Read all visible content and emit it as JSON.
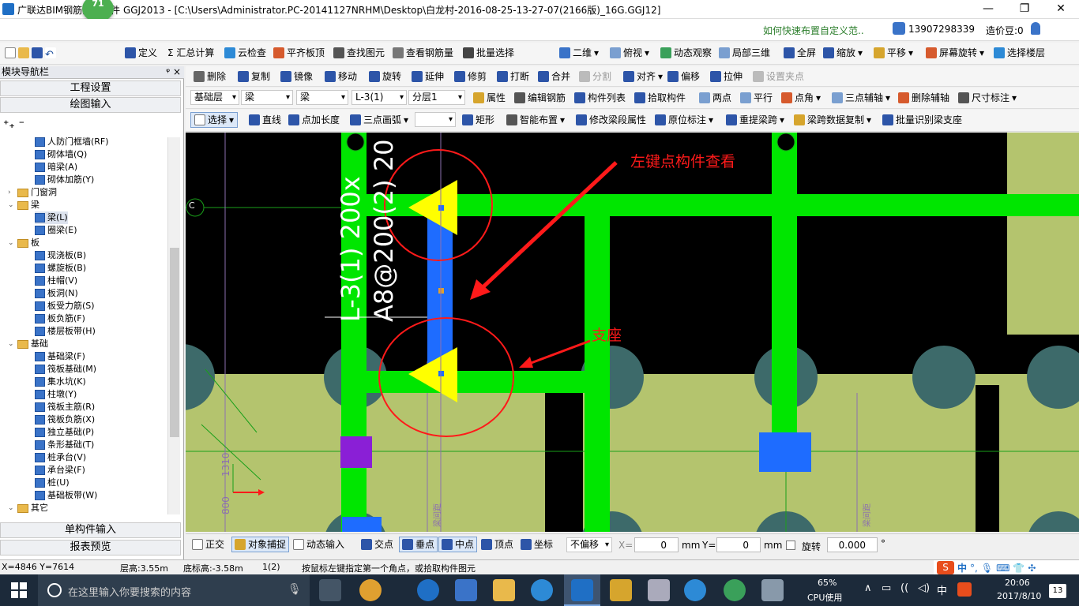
{
  "title": "广联达BIM钢筋算量软件 GGJ2013 - [C:\\Users\\Administrator.PC-20141127NRHM\\Desktop\\白龙村-2016-08-25-13-27-07(2166版)_16G.GGJ12]",
  "badge_count": "71",
  "window_controls": [
    "—",
    "❐",
    "✕"
  ],
  "help_link": "如何快速布置自定义范..",
  "user_phone": "13907298339",
  "zaojiadou": "造价豆:0",
  "toolbar1": [
    "定义",
    "Σ 汇总计算",
    "云检查",
    "平齐板顶",
    "查找图元",
    "查看钢筋量",
    "批量选择",
    "二维",
    "俯视",
    "动态观察",
    "局部三维",
    "全屏",
    "缩放",
    "平移",
    "屏幕旋转",
    "选择楼层"
  ],
  "toolbar2": [
    "删除",
    "复制",
    "镜像",
    "移动",
    "旋转",
    "延伸",
    "修剪",
    "打断",
    "合并",
    "分割",
    "对齐",
    "偏移",
    "拉伸",
    "设置夹点"
  ],
  "toolbar3": {
    "floor": "基础层",
    "type1": "梁",
    "type2": "梁",
    "component": "L-3(1)",
    "layer": "分层1",
    "buttons": [
      "属性",
      "编辑钢筋",
      "构件列表",
      "拾取构件",
      "两点",
      "平行",
      "点角",
      "三点辅轴",
      "删除辅轴",
      "尺寸标注"
    ]
  },
  "toolbar4": [
    "选择",
    "直线",
    "点加长度",
    "三点画弧",
    "矩形",
    "智能布置",
    "修改梁段属性",
    "原位标注",
    "重提梁跨",
    "梁跨数据复制",
    "批量识别梁支座"
  ],
  "nav": {
    "title": "模块导航栏",
    "pin": "ᵠ ×",
    "engineering": "工程设置",
    "drawing": "绘图输入",
    "single_input": "单构件输入",
    "report": "报表预览",
    "tree": [
      "人防门框墙(RF)",
      "砌体墙(Q)",
      "暗梁(A)",
      "砌体加筋(Y)",
      "门窗洞",
      "梁",
      "梁(L)",
      "圈梁(E)",
      "板",
      "现浇板(B)",
      "螺旋板(B)",
      "柱帽(V)",
      "板洞(N)",
      "板受力筋(S)",
      "板负筋(F)",
      "楼层板带(H)",
      "基础",
      "基础梁(F)",
      "筏板基础(M)",
      "集水坑(K)",
      "柱墩(Y)",
      "筏板主筋(R)",
      "筏板负筋(X)",
      "独立基础(P)",
      "条形基础(T)",
      "桩承台(V)",
      "承台梁(F)",
      "桩(U)",
      "基础板带(W)",
      "其它"
    ]
  },
  "canvas": {
    "annotation1": "左键点构件查看",
    "annotation2": "支座",
    "beam_label": "L-3(1) 200x",
    "rebar_label": "A8@200(2) 20",
    "axis_c": "C",
    "dim_small": "1310",
    "dim_small2": "800",
    "vert_text": "梁间距"
  },
  "bottombar": {
    "items": [
      "正交",
      "对象捕捉",
      "动态输入",
      "交点",
      "垂点",
      "中点",
      "顶点",
      "坐标"
    ],
    "offset_mode": "不偏移",
    "x_label": "X=",
    "x_value": "0",
    "mm1": "mm",
    "y_label": "Y=",
    "y_value": "0",
    "mm2": "mm",
    "rotate_label": "旋转",
    "rotate_value": "0.000",
    "deg": "°"
  },
  "status": {
    "coords": "X=4846 Y=7614",
    "floor_height": "层高:3.55m",
    "base_height": "底标高:-3.58m",
    "span": "1(2)",
    "hint": "按鼠标左键指定第一个角点，或拾取构件图元"
  },
  "taskbar": {
    "search_placeholder": "在这里输入你要搜索的内容",
    "cpu_percent": "65%",
    "cpu_label": "CPU使用",
    "ime": "中",
    "time": "20:06",
    "date": "2017/8/10",
    "notif": "13"
  },
  "colors": {
    "beam": "#00e600",
    "highlight_beam": "#1e6cff",
    "ground": "#b4c46e",
    "column": "#3d6a6a",
    "accent_red": "#ff1a1a",
    "selection_yellow": "#ffff00"
  }
}
